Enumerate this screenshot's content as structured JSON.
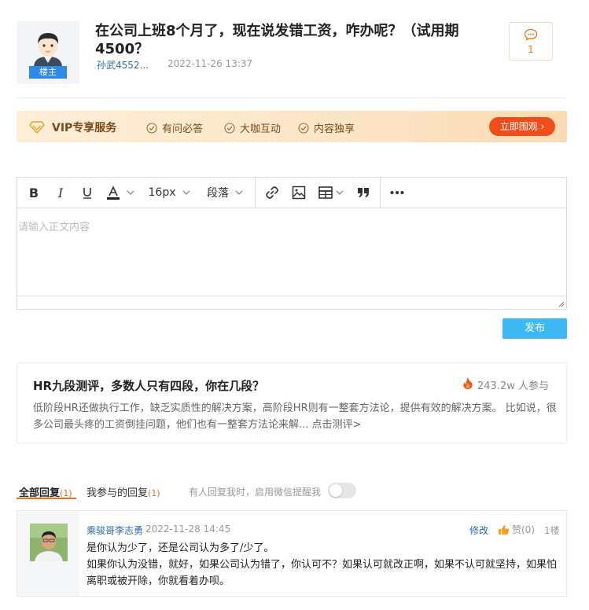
{
  "post": {
    "title": "在公司上班8个月了，现在说发错工资，咋办呢？（试用期4500？",
    "author": "孙武4552...",
    "time": "2022-11-26 13:37",
    "owner_badge": "楼主",
    "comment_count": "1"
  },
  "vip": {
    "title": "VIP专享服务",
    "features": [
      "有问必答",
      "大咖互动",
      "内容独享"
    ],
    "button": "立即围观 ›"
  },
  "editor": {
    "font_size": "16px",
    "paragraph": "段落",
    "placeholder": "请输入正文内容",
    "publish": "发布"
  },
  "promo": {
    "title": "HR九段测评，多数人只有四段，你在几段？",
    "count": "243.2w 人参与",
    "desc": "低阶段HR还做执行工作，缺乏实质性的解决方案，高阶段HR则有一整套方法论，提供有效的解决方案。 比如说，很多公司最头疼的工资倒挂问题，他们也有一整套方法论来解... 点击测评>"
  },
  "tabs": {
    "all_label": "全部回复",
    "all_count": "(1)",
    "mine_label": "我参与的回复",
    "mine_count": "(1)",
    "wechat_tip": "有人回复我时，启用微信提醒我"
  },
  "reply": {
    "author": "乘骏哥李志勇",
    "time": "2022-11-28 14:45",
    "edit": "修改",
    "like": "赞(0)",
    "floor": "1楼",
    "lines": [
      "是你认为少了，还是公司认为多了/少了。",
      "如果你认为没错，就好，如果公司认为错了，你认可不？如果认可就改正啊，如果不认可就坚持，如果怕离职或被开除，你就看着办呗。"
    ]
  },
  "colors": {
    "accent": "#e8731a",
    "link": "#2e6da4",
    "publish": "#3db8f5",
    "vip_button": "#f04d1a"
  }
}
